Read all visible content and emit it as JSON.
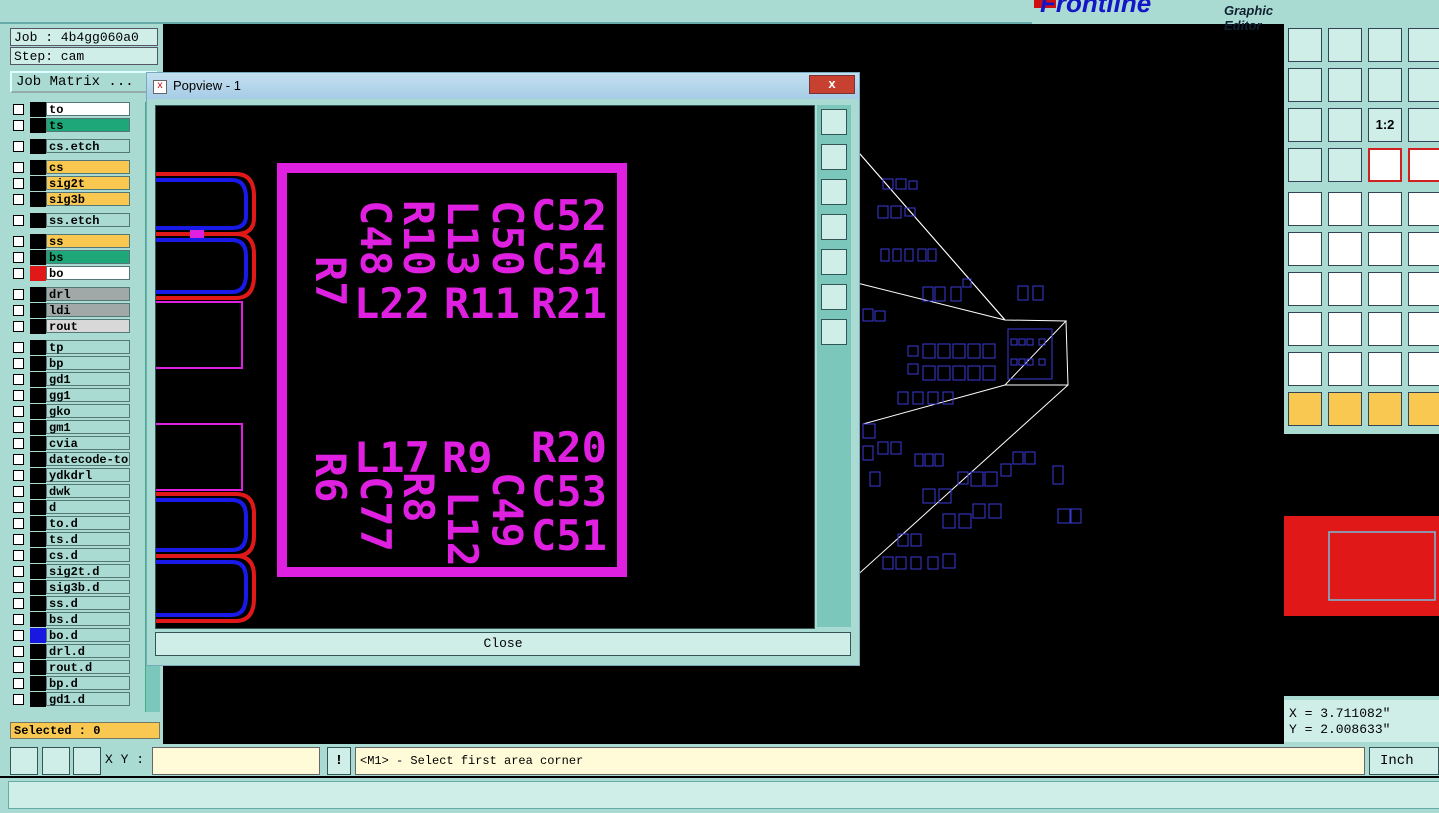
{
  "app": {
    "brand": "Frontline",
    "subtitle": "Graphic Editor"
  },
  "left_panel": {
    "job": "Job : 4b4gg060a0",
    "step": "Step: cam",
    "job_matrix": "Job Matrix ...",
    "selected": "Selected : 0",
    "layers": [
      {
        "name": "to",
        "color": "#ffffff",
        "group": 0
      },
      {
        "name": "ts",
        "color": "#1ea87a",
        "group": 0
      },
      {
        "name": "cs.etch",
        "color": "#a9dbd3",
        "group": 1
      },
      {
        "name": "cs",
        "color": "#f8c850",
        "group": 2
      },
      {
        "name": "sig2t",
        "color": "#f8c850",
        "group": 2
      },
      {
        "name": "sig3b",
        "color": "#f8c850",
        "group": 2
      },
      {
        "name": "ss.etch",
        "color": "#a9dbd3",
        "group": 3
      },
      {
        "name": "ss",
        "color": "#f8c850",
        "group": 4
      },
      {
        "name": "bs",
        "color": "#1ea87a",
        "group": 4
      },
      {
        "name": "bo",
        "color": "#ffffff",
        "group": 4,
        "swatch": "#e01818",
        "active": true
      },
      {
        "name": "drl",
        "color": "#a0a8a8",
        "group": 5
      },
      {
        "name": "ldi",
        "color": "#a0a8a8",
        "group": 5
      },
      {
        "name": "rout",
        "color": "#d8d8d8",
        "group": 5
      },
      {
        "name": "tp",
        "color": "#a9dbd3",
        "group": 6
      },
      {
        "name": "bp",
        "color": "#a9dbd3",
        "group": 6
      },
      {
        "name": "gd1",
        "color": "#a9dbd3",
        "group": 6
      },
      {
        "name": "gg1",
        "color": "#a9dbd3",
        "group": 6
      },
      {
        "name": "gko",
        "color": "#a9dbd3",
        "group": 6
      },
      {
        "name": "gm1",
        "color": "#a9dbd3",
        "group": 6
      },
      {
        "name": "cvia",
        "color": "#a9dbd3",
        "group": 6
      },
      {
        "name": "datecode-to",
        "color": "#a9dbd3",
        "group": 6
      },
      {
        "name": "ydkdrl",
        "color": "#a9dbd3",
        "group": 6
      },
      {
        "name": "dwk",
        "color": "#a9dbd3",
        "group": 6
      },
      {
        "name": "d",
        "color": "#a9dbd3",
        "group": 6
      },
      {
        "name": "to.d",
        "color": "#a9dbd3",
        "group": 6
      },
      {
        "name": "ts.d",
        "color": "#a9dbd3",
        "group": 6
      },
      {
        "name": "cs.d",
        "color": "#a9dbd3",
        "group": 6
      },
      {
        "name": "sig2t.d",
        "color": "#a9dbd3",
        "group": 6
      },
      {
        "name": "sig3b.d",
        "color": "#a9dbd3",
        "group": 6
      },
      {
        "name": "ss.d",
        "color": "#a9dbd3",
        "group": 6
      },
      {
        "name": "bs.d",
        "color": "#a9dbd3",
        "group": 6
      },
      {
        "name": "bo.d",
        "color": "#a9dbd3",
        "group": 6,
        "swatch": "#1818e0"
      },
      {
        "name": "drl.d",
        "color": "#a9dbd3",
        "group": 6
      },
      {
        "name": "rout.d",
        "color": "#a9dbd3",
        "group": 6
      },
      {
        "name": "bp.d",
        "color": "#a9dbd3",
        "group": 6
      },
      {
        "name": "gd1.d",
        "color": "#a9dbd3",
        "group": 6
      }
    ]
  },
  "popview": {
    "title": "Popview - 1",
    "close_label": "Close",
    "close_x": "x",
    "labels_top": [
      "C52",
      "C54",
      "R21",
      "C50",
      "L13",
      "R11",
      "R10",
      "L22",
      "C48",
      "R7"
    ],
    "labels_bottom": [
      "R20",
      "C53",
      "C51",
      "C49",
      "L12",
      "R9",
      "R8",
      "L17",
      "C77",
      "R6"
    ],
    "colors": {
      "silk": "#e020e0",
      "pad": "#1a1ae8",
      "outline": "#e01818"
    }
  },
  "right_panel": {
    "tool_icons": [
      "layer-up-icon",
      "layer-down-icon",
      "home-icon",
      "frame-icon",
      "prev-step-icon",
      "next-step-icon",
      "mirror-icon",
      "s-curve-icon",
      "zoom-fit-icon",
      "pan-icon",
      "scale-1-2-icon",
      "help-icon",
      "settings-icon",
      "grid-icon",
      "connect-icon",
      "snap-icon",
      "drill-icon",
      "cut-icon",
      "ruler-icon",
      "point-icon",
      "node-icon",
      "delete-icon",
      "line-icon",
      "arrow-line-icon",
      "angle-icon",
      "slash-icon",
      "arc-icon",
      "flip-icon",
      "move-icon",
      "minus-icon",
      "center-icon",
      "group-icon",
      "triangle-icon",
      "a-up-icon",
      "a-shape-icon",
      "a-cut-icon",
      "select-icon",
      "select-box-icon",
      "select-circle-icon",
      "select-path-icon"
    ],
    "scale_label": "1:2",
    "coords_x": "X = 3.711082\"",
    "coords_y": "Y = 2.008633\""
  },
  "bottom": {
    "xy_label": "X Y :",
    "excl": "!",
    "prompt": "<M1> - Select first area corner",
    "units": "Inch"
  }
}
